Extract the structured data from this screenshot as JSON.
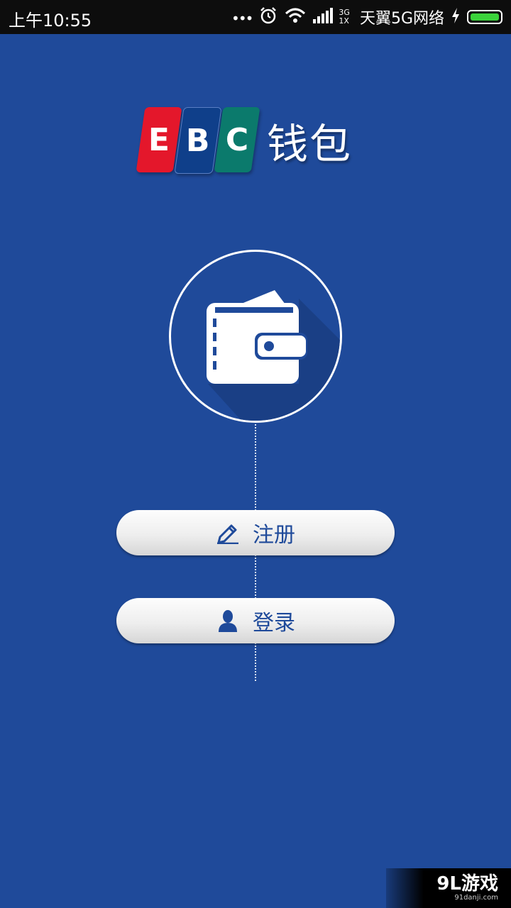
{
  "status_bar": {
    "time": "上午10:55",
    "network_top": "3G",
    "network_bottom": "1X",
    "carrier": "天翼5G网络"
  },
  "logo": {
    "letters": [
      "E",
      "B",
      "C"
    ],
    "text": "钱包",
    "colors": [
      "#e4172b",
      "#0f3f8a",
      "#0b7a6c"
    ]
  },
  "buttons": {
    "register_label": "注册",
    "login_label": "登录"
  },
  "icons": {
    "register": "pencil-icon",
    "login": "user-icon",
    "center": "wallet-icon"
  },
  "watermark": {
    "main": "9L游戏",
    "sub": "91danji.com"
  },
  "colors": {
    "background": "#1f4a9a",
    "accent": "#1f4a9a"
  }
}
